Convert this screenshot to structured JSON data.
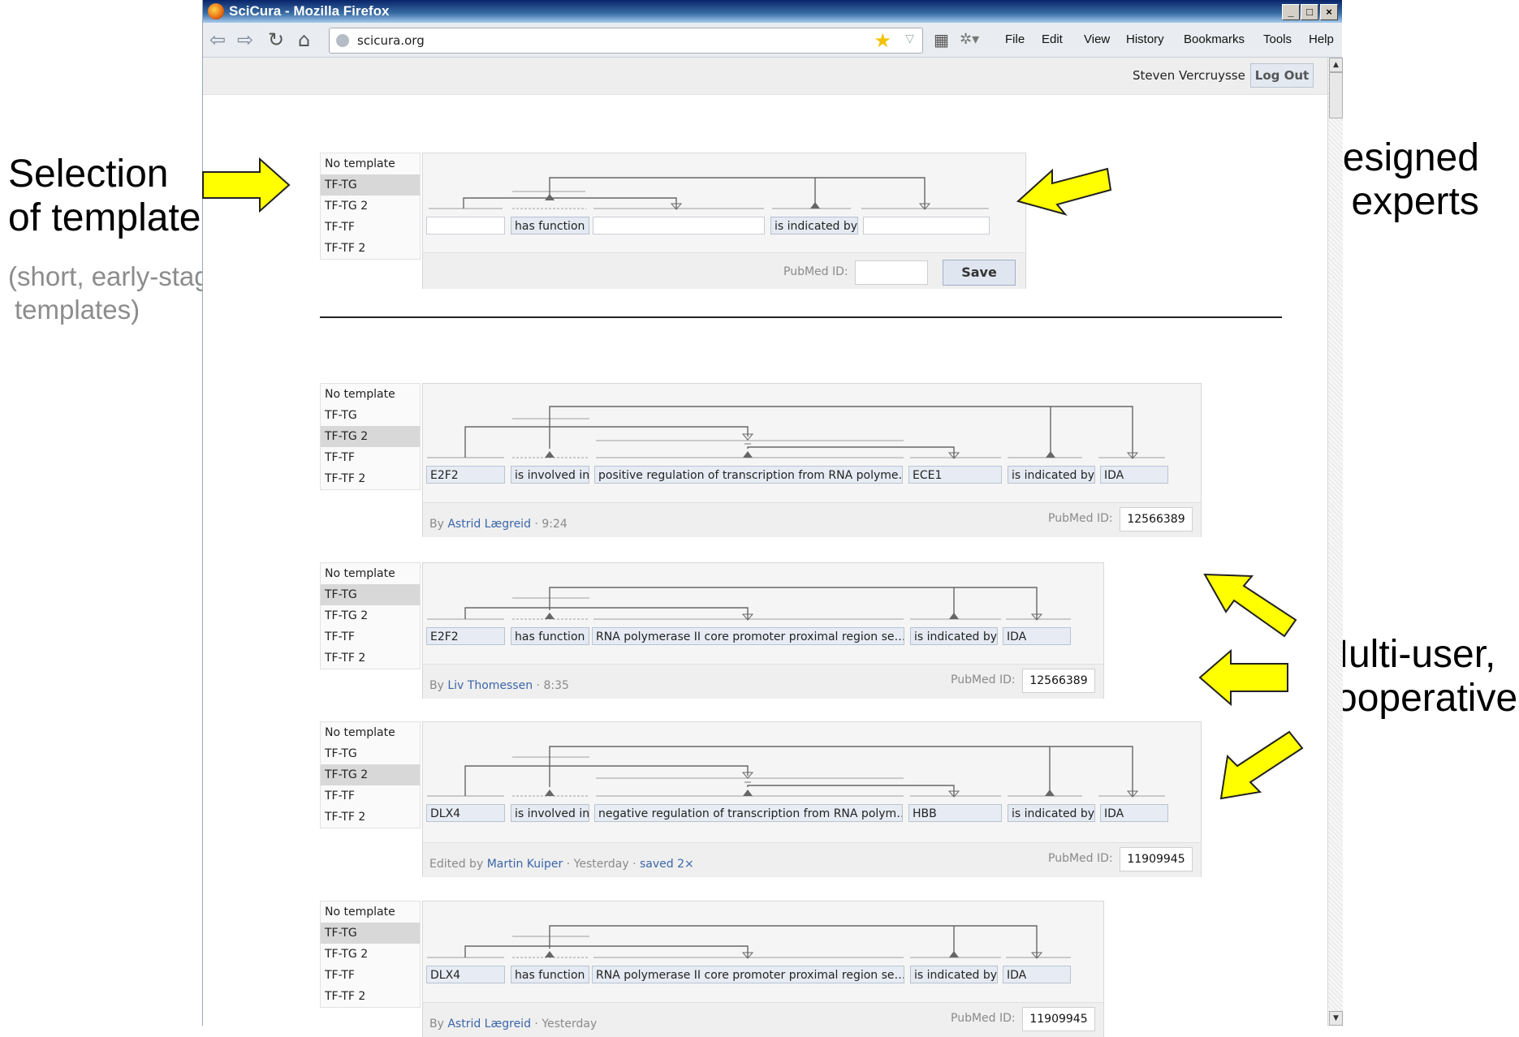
{
  "callouts": {
    "selection_line1": "Selection",
    "selection_line2": "of templates",
    "selection_note_line1": "(short, early-stage",
    "selection_note_line2": "templates)",
    "designed_line1": "Templates designed",
    "designed_line2": "with domain experts",
    "multiuser_line1": "Multi-user,",
    "multiuser_line2": "cooperative"
  },
  "browser": {
    "title": "SciCura - Mozilla Firefox",
    "url": "scicura.org",
    "menu": [
      "File",
      "Edit",
      "View",
      "History",
      "Bookmarks",
      "Tools",
      "Help"
    ],
    "user": "Steven Vercruysse",
    "logout": "Log Out"
  },
  "templates": [
    "No template",
    "TF-TG",
    "TF-TG 2",
    "TF-TF",
    "TF-TF 2"
  ],
  "pubmed_label": "PubMed ID:",
  "save_label": "Save",
  "new_form": {
    "selected_template": 1,
    "fields": [
      "",
      "has function",
      "",
      "is indicated by",
      ""
    ]
  },
  "forms": [
    {
      "selected_template": 2,
      "fields": [
        "E2F2",
        "is involved in",
        "positive regulation of transcription from RNA polyme…",
        "ECE1",
        "is indicated by",
        "IDA"
      ],
      "meta_prefix": "By ",
      "author": "Astrid Lægreid",
      "meta_suffix": " · 9:24",
      "extra": "",
      "pubmed": "12566389"
    },
    {
      "selected_template": 1,
      "fields": [
        "E2F2",
        "has function",
        "RNA polymerase II core promoter proximal region se…",
        "is indicated by",
        "IDA"
      ],
      "meta_prefix": "By ",
      "author": "Liv Thomessen",
      "meta_suffix": " · 8:35",
      "extra": "",
      "pubmed": "12566389"
    },
    {
      "selected_template": 2,
      "fields": [
        "DLX4",
        "is involved in",
        "negative regulation of transcription from RNA polym…",
        "HBB",
        "is indicated by",
        "IDA"
      ],
      "meta_prefix": "Edited by ",
      "author": "Martin Kuiper",
      "meta_suffix": " · Yesterday · ",
      "extra": "saved 2×",
      "pubmed": "11909945"
    },
    {
      "selected_template": 1,
      "fields": [
        "DLX4",
        "has function",
        "RNA polymerase II core promoter proximal region se…",
        "is indicated by",
        "IDA"
      ],
      "meta_prefix": "By ",
      "author": "Astrid Lægreid",
      "meta_suffix": " · Yesterday",
      "extra": "",
      "pubmed": "11909945"
    }
  ]
}
